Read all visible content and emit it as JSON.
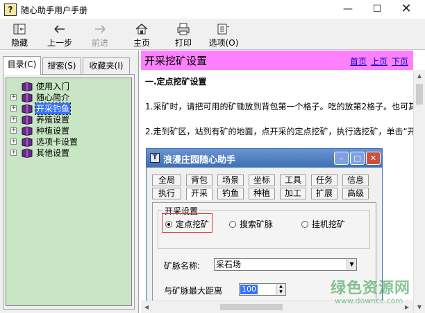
{
  "window": {
    "title": "随心助手用户手册"
  },
  "toolbar": {
    "hide": "隐藏",
    "back": "上一步",
    "forward": "前进",
    "home": "主页",
    "print": "打印",
    "options": "选项(O)"
  },
  "sidebar": {
    "tabs": [
      "目录(C)",
      "搜索(S)",
      "收藏夹(I)"
    ],
    "items": [
      {
        "label": "使用入门",
        "expandable": false
      },
      {
        "label": "随心简介",
        "expandable": true
      },
      {
        "label": "开采钓鱼",
        "expandable": true
      },
      {
        "label": "养殖设置",
        "expandable": true
      },
      {
        "label": "种植设置",
        "expandable": true
      },
      {
        "label": "选项卡设置",
        "expandable": true
      },
      {
        "label": "其他设置",
        "expandable": true
      }
    ]
  },
  "page": {
    "title": "开采挖矿设置",
    "nav": {
      "first": "首页",
      "prev": "上页",
      "next": "下页"
    },
    "section": "一.定点挖矿设置",
    "para1": "1.采矿时，请把可用的矿锄放到背包第一个格子。吃的放第2格子。也可其",
    "para2": "2.走到矿区，站到有矿的地面，点开采的定点挖矿，执行选挖矿，单击“开"
  },
  "dialog": {
    "title": "浪漫庄园随心助手",
    "tabs_row1": [
      "全局",
      "背包",
      "场景",
      "坐标",
      "工具",
      "任务",
      "信息"
    ],
    "tabs_row2": [
      "执行",
      "开采",
      "钓鱼",
      "种植",
      "加工",
      "扩展",
      "高级"
    ],
    "group_label": "开采设置",
    "radios": [
      "定点挖矿",
      "搜索矿脉",
      "挂机挖矿"
    ],
    "vein_label": "矿脉名称:",
    "vein_value": "采石场",
    "distance_label": "与矿脉最大距离",
    "distance_value": "100"
  },
  "watermark": {
    "main": "绿色资源网",
    "sub": "www.downcc.com"
  }
}
